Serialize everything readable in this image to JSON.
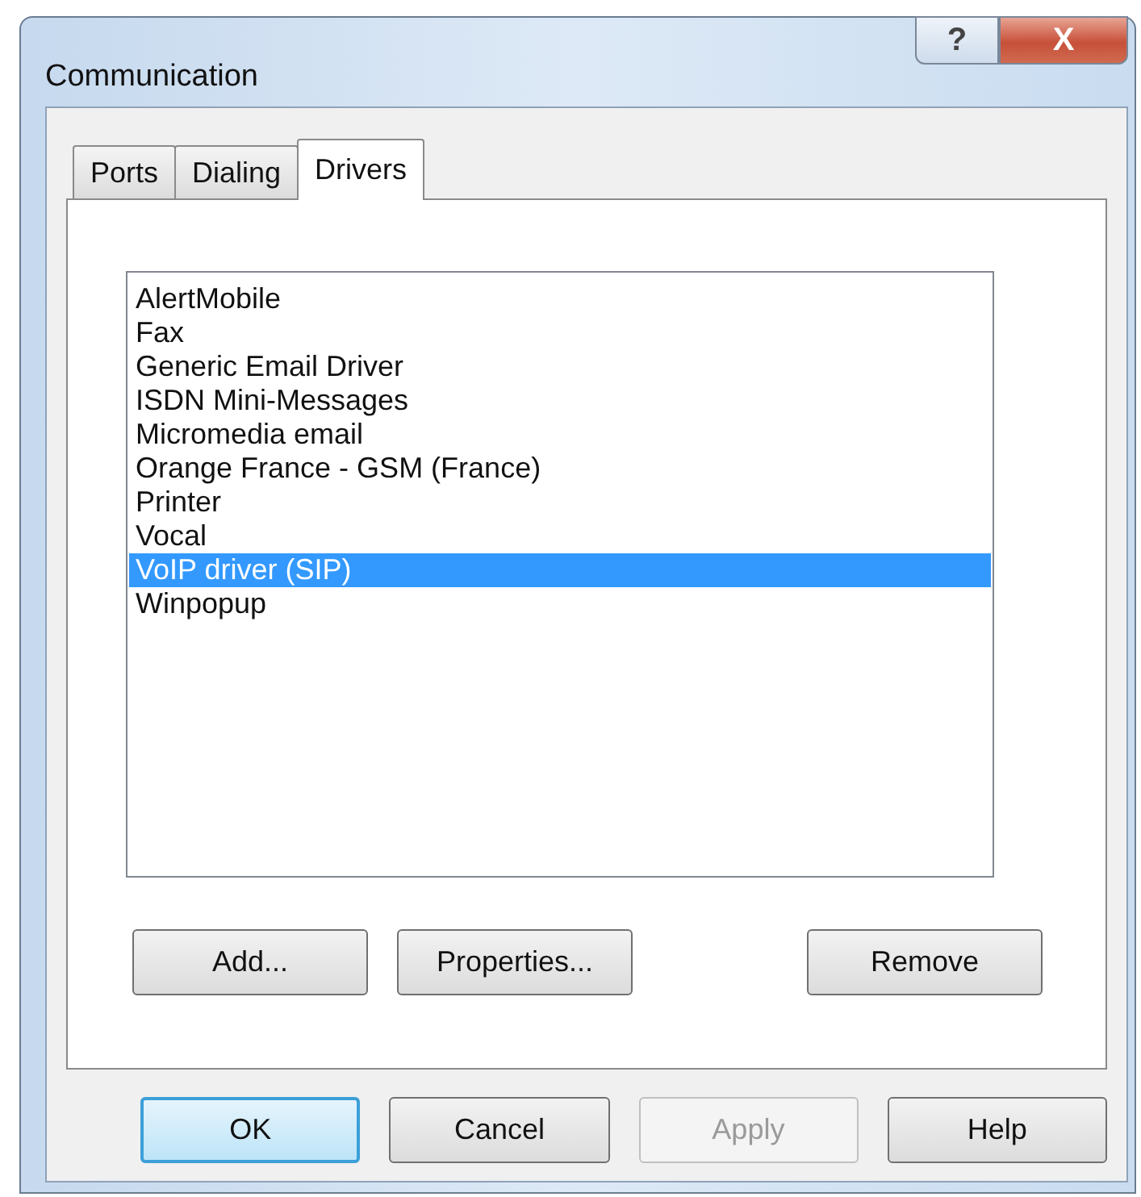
{
  "window": {
    "title": "Communication",
    "help_glyph": "?",
    "close_glyph": "X"
  },
  "tabs": [
    {
      "label": "Ports",
      "selected": false
    },
    {
      "label": "Dialing",
      "selected": false
    },
    {
      "label": "Drivers",
      "selected": true
    }
  ],
  "drivers": [
    {
      "label": "AlertMobile",
      "selected": false
    },
    {
      "label": "Fax",
      "selected": false
    },
    {
      "label": "Generic Email Driver",
      "selected": false
    },
    {
      "label": "ISDN Mini-Messages",
      "selected": false
    },
    {
      "label": "Micromedia email",
      "selected": false
    },
    {
      "label": "Orange France - GSM (France)",
      "selected": false
    },
    {
      "label": "Printer",
      "selected": false
    },
    {
      "label": "Vocal",
      "selected": false
    },
    {
      "label": "VoIP driver (SIP)",
      "selected": true
    },
    {
      "label": "Winpopup",
      "selected": false
    }
  ],
  "driver_buttons": [
    {
      "label": "Add..."
    },
    {
      "label": "Properties..."
    },
    {
      "label": "Remove"
    }
  ],
  "dialog_buttons": [
    {
      "label": "OK",
      "default": true,
      "disabled": false
    },
    {
      "label": "Cancel",
      "default": false,
      "disabled": false
    },
    {
      "label": "Apply",
      "default": false,
      "disabled": true
    },
    {
      "label": "Help",
      "default": false,
      "disabled": false
    }
  ]
}
